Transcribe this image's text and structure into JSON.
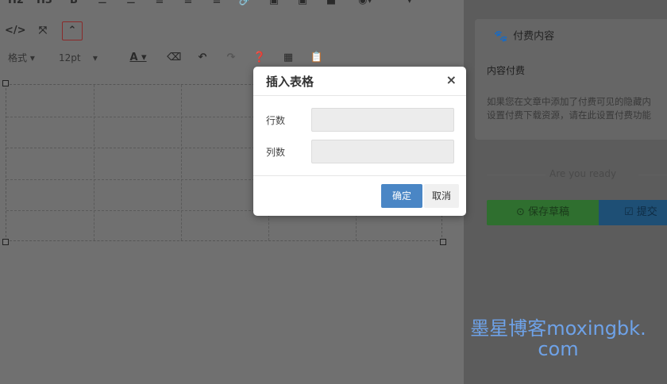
{
  "toolbar1": {
    "h2": "H2",
    "h3": "H3",
    "bold": "B"
  },
  "toolbar3": {
    "format_label": "格式",
    "font_size": "12pt",
    "font_color": "A"
  },
  "sidebar": {
    "card_title": "付费内容",
    "card_sub": "内容付费",
    "card_desc_line1": "如果您在文章中添加了付费可见的隐藏内",
    "card_desc_line2": "设置付费下载资源，请在此设置付费功能",
    "are_you_ready": "Are you ready",
    "save_draft": "保存草稿",
    "submit": "提交"
  },
  "modal": {
    "title": "插入表格",
    "close": "×",
    "rows_label": "行数",
    "cols_label": "列数",
    "rows_value": "",
    "cols_value": "",
    "ok": "确定",
    "cancel": "取消"
  },
  "watermark": {
    "line1": "墨星博客moxingbk.",
    "line2": "com"
  },
  "colors": {
    "ok_button": "#4a86c5",
    "save_button": "#2f6f2f",
    "submit_button": "#1e4f75",
    "watermark": "#6ea2e8"
  }
}
